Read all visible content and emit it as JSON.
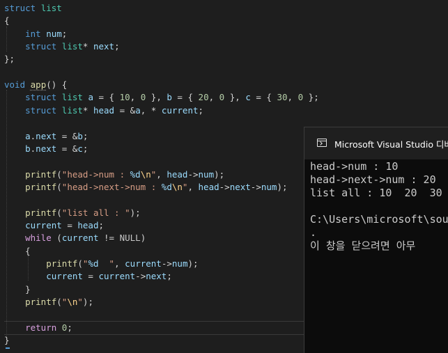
{
  "editor": {
    "code_lines": [
      [
        [
          "k",
          "struct"
        ],
        [
          "o",
          " "
        ],
        [
          "t",
          "list"
        ]
      ],
      [
        [
          "o",
          "{"
        ]
      ],
      [
        [
          "o",
          "    "
        ],
        [
          "k",
          "int"
        ],
        [
          "o",
          " "
        ],
        [
          "v",
          "num"
        ],
        [
          "o",
          ";"
        ]
      ],
      [
        [
          "o",
          "    "
        ],
        [
          "k",
          "struct"
        ],
        [
          "o",
          " "
        ],
        [
          "t",
          "list"
        ],
        [
          "o",
          "* "
        ],
        [
          "v",
          "next"
        ],
        [
          "o",
          ";"
        ]
      ],
      [
        [
          "o",
          "};"
        ]
      ],
      [
        [
          "o",
          ""
        ]
      ],
      [
        [
          "k",
          "void"
        ],
        [
          "o",
          " "
        ],
        [
          "f",
          "app"
        ],
        [
          "o",
          "() {"
        ]
      ],
      [
        [
          "o",
          "    "
        ],
        [
          "k",
          "struct"
        ],
        [
          "o",
          " "
        ],
        [
          "t",
          "list"
        ],
        [
          "o",
          " "
        ],
        [
          "v",
          "a"
        ],
        [
          "o",
          " = { "
        ],
        [
          "n",
          "10"
        ],
        [
          "o",
          ", "
        ],
        [
          "n",
          "0"
        ],
        [
          "o",
          " }, "
        ],
        [
          "v",
          "b"
        ],
        [
          "o",
          " = { "
        ],
        [
          "n",
          "20"
        ],
        [
          "o",
          ", "
        ],
        [
          "n",
          "0"
        ],
        [
          "o",
          " }, "
        ],
        [
          "v",
          "c"
        ],
        [
          "o",
          " = { "
        ],
        [
          "n",
          "30"
        ],
        [
          "o",
          ", "
        ],
        [
          "n",
          "0"
        ],
        [
          "o",
          " };"
        ]
      ],
      [
        [
          "o",
          "    "
        ],
        [
          "k",
          "struct"
        ],
        [
          "o",
          " "
        ],
        [
          "t",
          "list"
        ],
        [
          "o",
          "* "
        ],
        [
          "v",
          "head"
        ],
        [
          "o",
          " = &"
        ],
        [
          "v",
          "a"
        ],
        [
          "o",
          ", * "
        ],
        [
          "v",
          "current"
        ],
        [
          "o",
          ";"
        ]
      ],
      [
        [
          "o",
          ""
        ]
      ],
      [
        [
          "o",
          "    "
        ],
        [
          "v",
          "a"
        ],
        [
          "o",
          "."
        ],
        [
          "v",
          "next"
        ],
        [
          "o",
          " = &"
        ],
        [
          "v",
          "b"
        ],
        [
          "o",
          ";"
        ]
      ],
      [
        [
          "o",
          "    "
        ],
        [
          "v",
          "b"
        ],
        [
          "o",
          "."
        ],
        [
          "v",
          "next"
        ],
        [
          "o",
          " = &"
        ],
        [
          "v",
          "c"
        ],
        [
          "o",
          ";"
        ]
      ],
      [
        [
          "o",
          ""
        ]
      ],
      [
        [
          "o",
          "    "
        ],
        [
          "f",
          "printf"
        ],
        [
          "o",
          "("
        ],
        [
          "s",
          "\"head->num : "
        ],
        [
          "v",
          "%d"
        ],
        [
          "e",
          "\\n"
        ],
        [
          "s",
          "\""
        ],
        [
          "o",
          ", "
        ],
        [
          "v",
          "head"
        ],
        [
          "o",
          "->"
        ],
        [
          "v",
          "num"
        ],
        [
          "o",
          ");"
        ]
      ],
      [
        [
          "o",
          "    "
        ],
        [
          "f",
          "printf"
        ],
        [
          "o",
          "("
        ],
        [
          "s",
          "\"head->next->num : "
        ],
        [
          "v",
          "%d"
        ],
        [
          "e",
          "\\n"
        ],
        [
          "s",
          "\""
        ],
        [
          "o",
          ", "
        ],
        [
          "v",
          "head"
        ],
        [
          "o",
          "->"
        ],
        [
          "v",
          "next"
        ],
        [
          "o",
          "->"
        ],
        [
          "v",
          "num"
        ],
        [
          "o",
          ");"
        ]
      ],
      [
        [
          "o",
          ""
        ]
      ],
      [
        [
          "o",
          "    "
        ],
        [
          "f",
          "printf"
        ],
        [
          "o",
          "("
        ],
        [
          "s",
          "\"list all : \""
        ],
        [
          "o",
          ");"
        ]
      ],
      [
        [
          "o",
          "    "
        ],
        [
          "v",
          "current"
        ],
        [
          "o",
          " = "
        ],
        [
          "v",
          "head"
        ],
        [
          "o",
          ";"
        ]
      ],
      [
        [
          "o",
          "    "
        ],
        [
          "ctl",
          "while"
        ],
        [
          "o",
          " ("
        ],
        [
          "v",
          "current"
        ],
        [
          "o",
          " != "
        ],
        [
          "m",
          "NULL"
        ],
        [
          "o",
          ")"
        ]
      ],
      [
        [
          "o",
          "    {"
        ]
      ],
      [
        [
          "o",
          "        "
        ],
        [
          "f",
          "printf"
        ],
        [
          "o",
          "("
        ],
        [
          "s",
          "\""
        ],
        [
          "v",
          "%d"
        ],
        [
          "s",
          "  \""
        ],
        [
          "o",
          ", "
        ],
        [
          "v",
          "current"
        ],
        [
          "o",
          "->"
        ],
        [
          "v",
          "num"
        ],
        [
          "o",
          ");"
        ]
      ],
      [
        [
          "o",
          "        "
        ],
        [
          "v",
          "current"
        ],
        [
          "o",
          " = "
        ],
        [
          "v",
          "current"
        ],
        [
          "o",
          "->"
        ],
        [
          "v",
          "next"
        ],
        [
          "o",
          ";"
        ]
      ],
      [
        [
          "o",
          "    }"
        ]
      ],
      [
        [
          "o",
          "    "
        ],
        [
          "f",
          "printf"
        ],
        [
          "o",
          "("
        ],
        [
          "s",
          "\""
        ],
        [
          "e",
          "\\n"
        ],
        [
          "s",
          "\""
        ],
        [
          "o",
          ");"
        ]
      ],
      [
        [
          "o",
          ""
        ]
      ],
      [
        [
          "o",
          "    "
        ],
        [
          "ctl",
          "return"
        ],
        [
          "o",
          " "
        ],
        [
          "n",
          "0"
        ],
        [
          "o",
          ";"
        ]
      ],
      [
        [
          "o",
          "}"
        ]
      ]
    ]
  },
  "console": {
    "title": "Microsoft Visual Studio 디버그",
    "lines": [
      "head->num : 10",
      "head->next->num : 20",
      "list all : 10  20  30",
      "",
      "C:\\Users\\microsoft\\sou",
      ".",
      "이 창을 닫으려면 아무"
    ]
  }
}
